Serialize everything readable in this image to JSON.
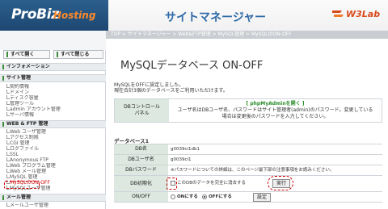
{
  "header": {
    "logo_main": "ProBiz",
    "logo_sub": "Hosting",
    "site_title": "サイトマネージャー",
    "brand": "W3Lab",
    "brand_color": "#d84b1d"
  },
  "breadcrumb": "TOP > サイトマネージャー > Web&FTP管理 > MySQL管理 > MySQLのON-OFF",
  "sidebar": {
    "expand_all": "すべて開く",
    "collapse_all": "すべて閉じる",
    "sections": [
      {
        "label": "インフォメーション",
        "items": []
      },
      {
        "label": "サイト管理",
        "items": [
          "契約情報",
          "ドメイン",
          "ディスク容量",
          "管理ツール",
          "admin アカウント管理",
          "サーバ情報"
        ]
      },
      {
        "label": "WEB & FTP 管理",
        "items": [
          "Web ユーザ管理",
          "アクセス制限",
          "CGI 管理",
          "ログファイル",
          "SSL",
          "Anonymous FTP",
          "Web プログラム管理",
          "Web メール管理",
          "MySQL 管理",
          "MySQLのON-OFF",
          "MySQLユーザ管理"
        ]
      },
      {
        "label": "メール管理",
        "items": [
          "メールユーザ管理"
        ]
      }
    ],
    "active_item": "MySQLのON-OFF"
  },
  "main": {
    "title": "MySQLデータベース ON-OFF",
    "notice_line1": "MySQLをOFFに設定しました。",
    "notice_line2": "現在合計3個のデータベースをご利用いただけます。",
    "db_control": {
      "label_line1": "DBコントロール",
      "label_line2": "パネル",
      "link": "[ phpMyAdminを開く ]",
      "desc_line1": "ユーザ名はDBユーザ名、パスワードはサイト管理者(admin)のパスワード。変更している",
      "desc_line2": "場合は変更後のパスワードを入力してください。"
    },
    "db_section_title": "データベース1",
    "rows": {
      "db_name_label": "DB名",
      "db_name_value": "g0039ci1db1",
      "db_user_label": "DBユーザ名",
      "db_user_value": "g0039ci1",
      "db_pass_label": "DBパスワード",
      "db_pass_value": "※パスワードについての詳細は、このページ最下部の注意事項をお読みください。",
      "db_init_label": "DB初期化",
      "db_init_text": "このDBのデータを完全に消去する",
      "exec_button": "実行",
      "onoff_label": "ON/OFF",
      "on_label": "ONにする",
      "off_label": "OFFにする",
      "set_button": "設定",
      "selected": "OFF"
    }
  }
}
